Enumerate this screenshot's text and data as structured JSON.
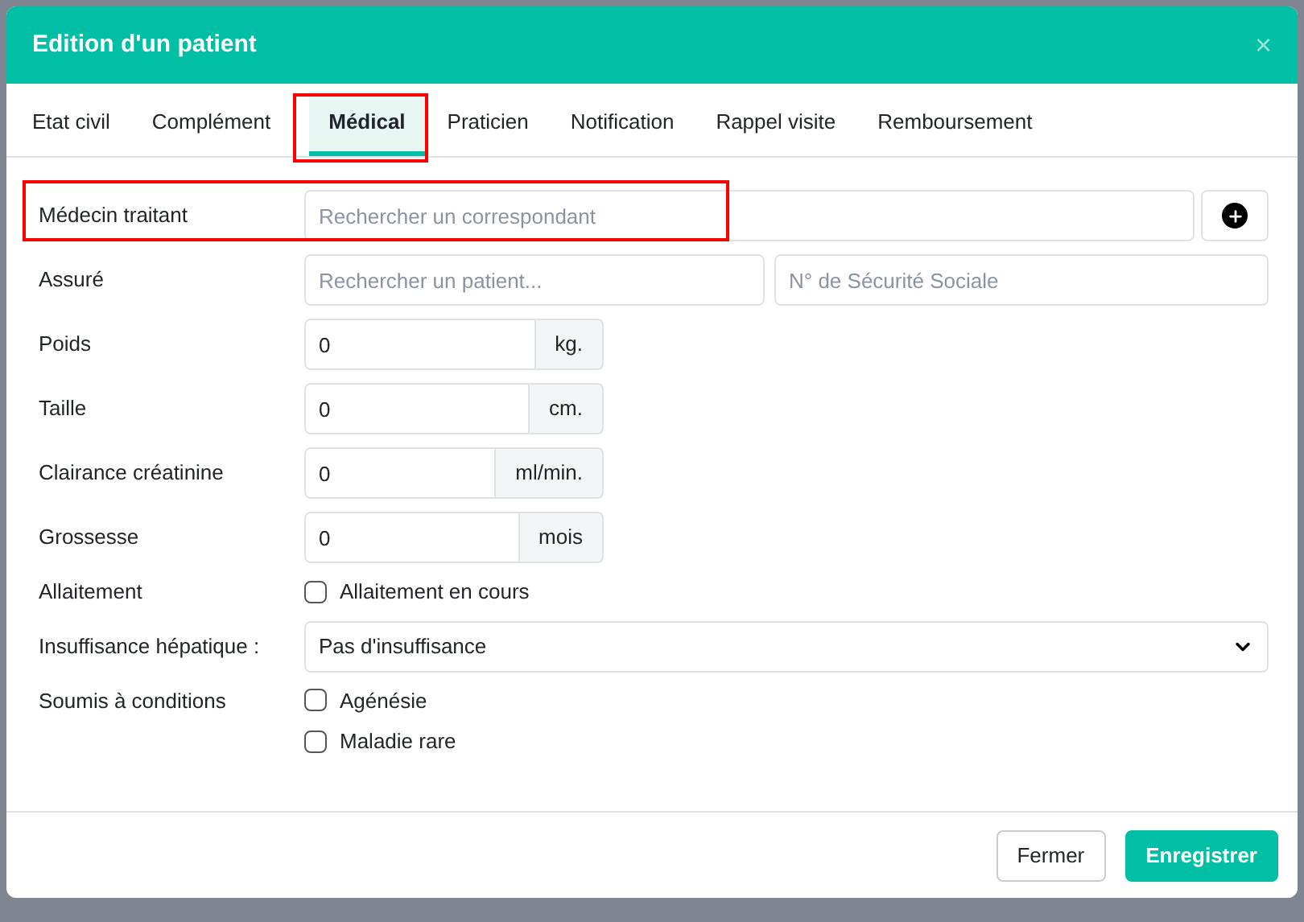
{
  "dialog": {
    "title": "Edition d'un patient",
    "close": "×"
  },
  "tabs": [
    {
      "label": "Etat civil",
      "selected": false,
      "highlighted": false
    },
    {
      "label": "Complément",
      "selected": false,
      "highlighted": false
    },
    {
      "label": "Médical",
      "selected": true,
      "highlighted": true
    },
    {
      "label": "Praticien",
      "selected": false,
      "highlighted": false
    },
    {
      "label": "Notification",
      "selected": false,
      "highlighted": false
    },
    {
      "label": "Rappel visite",
      "selected": false,
      "highlighted": false
    },
    {
      "label": "Remboursement",
      "selected": false,
      "highlighted": false
    }
  ],
  "rows": [
    {
      "kind": "search_add",
      "label": "Médecin traitant",
      "placeholder": "Rechercher un correspondant",
      "highlighted": true
    },
    {
      "kind": "double",
      "label": "Assuré",
      "placeholder": "Rechercher un patient...",
      "placeholder_2": "N° de Sécurité Sociale",
      "highlighted": false
    },
    {
      "kind": "unit",
      "label": "Poids",
      "value": "0",
      "unit": "kg.",
      "highlighted": false
    },
    {
      "kind": "unit",
      "label": "Taille",
      "value": "0",
      "unit": "cm.",
      "highlighted": false
    },
    {
      "kind": "unit",
      "label": "Clairance créatinine",
      "value": "0",
      "unit": "ml/min.",
      "highlighted": false
    },
    {
      "kind": "unit",
      "label": "Grossesse",
      "value": "0",
      "unit": "mois",
      "highlighted": false
    },
    {
      "kind": "checks",
      "label": "Allaitement",
      "options": [
        {
          "label": "Allaitement en cours",
          "checked": false
        }
      ],
      "highlighted": false
    },
    {
      "kind": "select",
      "label": "Insuffisance hépatique :",
      "value": "Pas d'insuffisance",
      "highlighted": false
    },
    {
      "kind": "checks",
      "label": "Soumis à conditions",
      "options": [
        {
          "label": "Agénésie",
          "checked": false
        },
        {
          "label": "Maladie rare",
          "checked": false
        }
      ],
      "highlighted": false
    }
  ],
  "buttons": [
    {
      "label": "Fermer",
      "kind": "secondary"
    },
    {
      "label": "Enregistrer",
      "kind": "primary"
    }
  ]
}
